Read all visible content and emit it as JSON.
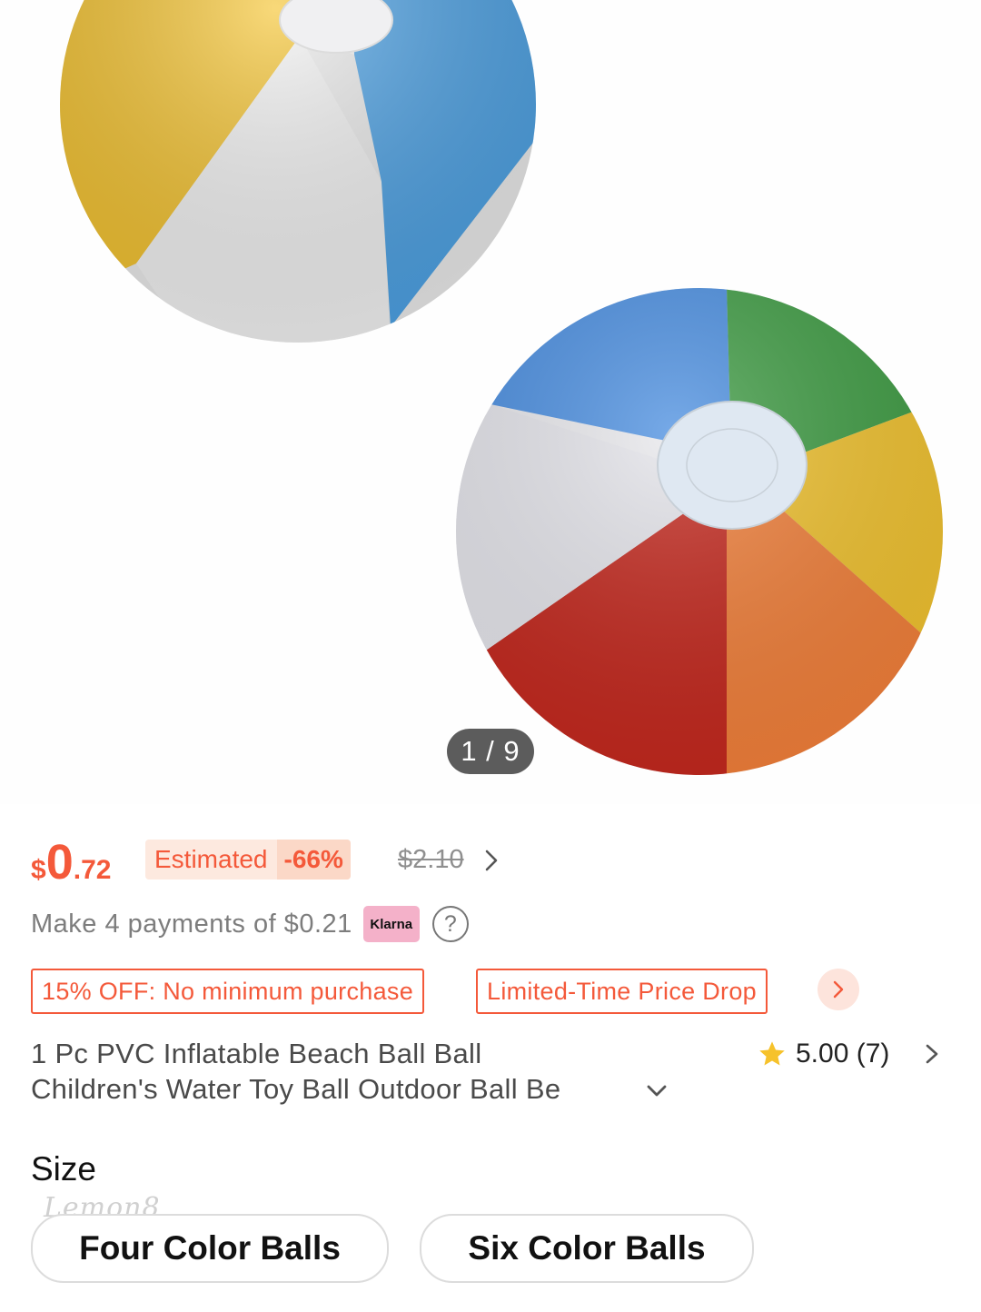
{
  "gallery": {
    "counter": "1 / 9"
  },
  "price": {
    "currency": "$",
    "integer": "0",
    "decimal": ".72"
  },
  "estimate": {
    "label": "Estimated",
    "discount": "-66%"
  },
  "original_price": "$2.10",
  "installments": {
    "text": "Make 4 payments of $0.21",
    "provider": "Klarna",
    "help_symbol": "?"
  },
  "promos": [
    "15% OFF: No minimum purchase",
    "Limited-Time Price Drop"
  ],
  "product": {
    "title_line1": "1 Pc PVC Inflatable Beach Ball Ball",
    "title_line2": "Children's Water Toy Ball Outdoor Ball Be"
  },
  "rating": {
    "value": "5.00 (7)"
  },
  "size": {
    "label": "Size",
    "options": [
      "Four Color Balls",
      "Six Color Balls"
    ]
  },
  "watermark": "Lemon8",
  "colors": {
    "accent": "#f4593a",
    "star": "#f6c22b",
    "klarna_pink": "#f4b1c9"
  },
  "icons": [
    "chevron-right-icon",
    "question-circle-icon",
    "star-icon",
    "chevron-down-icon"
  ]
}
